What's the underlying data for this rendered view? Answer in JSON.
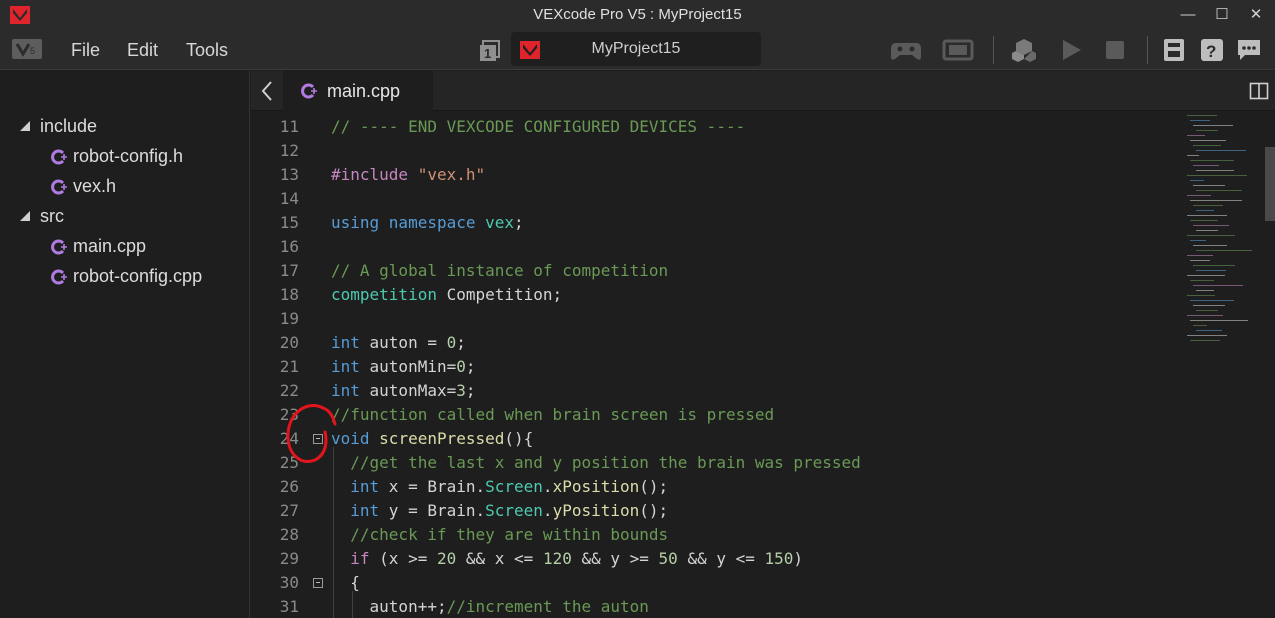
{
  "window": {
    "title": "VEXcode Pro V5 : MyProject15",
    "minimize_glyph": "—",
    "maximize_glyph": "☐",
    "close_glyph": "✕"
  },
  "menu": {
    "items": [
      "File",
      "Edit",
      "Tools"
    ]
  },
  "project": {
    "count": "1",
    "name": "MyProject15"
  },
  "toolbar": {
    "icons": [
      "controller-icon",
      "brain-icon",
      "download-icon",
      "play-icon",
      "stop-icon",
      "device-info-icon",
      "help-icon",
      "feedback-icon"
    ]
  },
  "sidebar": {
    "folders": [
      {
        "name": "include",
        "files": [
          "robot-config.h",
          "vex.h"
        ]
      },
      {
        "name": "src",
        "files": [
          "main.cpp",
          "robot-config.cpp"
        ]
      }
    ]
  },
  "tab": {
    "label": "main.cpp"
  },
  "code": {
    "lines": [
      {
        "n": "11",
        "segs": [
          [
            "c-comment",
            "// ---- END VEXCODE CONFIGURED DEVICES ----"
          ]
        ]
      },
      {
        "n": "12",
        "segs": []
      },
      {
        "n": "13",
        "segs": [
          [
            "c-ctrl",
            "#include "
          ],
          [
            "c-str",
            "\"vex.h\""
          ]
        ]
      },
      {
        "n": "14",
        "segs": []
      },
      {
        "n": "15",
        "segs": [
          [
            "c-kw",
            "using namespace "
          ],
          [
            "c-type",
            "vex"
          ],
          [
            "c-var",
            ";"
          ]
        ]
      },
      {
        "n": "16",
        "segs": []
      },
      {
        "n": "17",
        "segs": [
          [
            "c-comment",
            "// A global instance of competition"
          ]
        ]
      },
      {
        "n": "18",
        "segs": [
          [
            "c-type",
            "competition "
          ],
          [
            "c-var",
            "Competition;"
          ]
        ]
      },
      {
        "n": "19",
        "segs": []
      },
      {
        "n": "20",
        "segs": [
          [
            "c-kw",
            "int "
          ],
          [
            "c-var",
            "auton = "
          ],
          [
            "c-num",
            "0"
          ],
          [
            "c-var",
            ";"
          ]
        ]
      },
      {
        "n": "21",
        "segs": [
          [
            "c-kw",
            "int "
          ],
          [
            "c-var",
            "autonMin="
          ],
          [
            "c-num",
            "0"
          ],
          [
            "c-var",
            ";"
          ]
        ]
      },
      {
        "n": "22",
        "segs": [
          [
            "c-kw",
            "int "
          ],
          [
            "c-var",
            "autonMax="
          ],
          [
            "c-num",
            "3"
          ],
          [
            "c-var",
            ";"
          ]
        ]
      },
      {
        "n": "23",
        "segs": [
          [
            "c-comment",
            "//function called when brain screen is pressed"
          ]
        ]
      },
      {
        "n": "24",
        "fold": true,
        "segs": [
          [
            "c-kw",
            "void "
          ],
          [
            "c-fn",
            "screenPressed"
          ],
          [
            "c-var",
            "(){"
          ]
        ]
      },
      {
        "n": "25",
        "segs": [
          [
            "c-comment",
            "  //get the last x and y position the brain was pressed"
          ]
        ]
      },
      {
        "n": "26",
        "segs": [
          [
            "c-kw",
            "  int "
          ],
          [
            "c-var",
            "x = Brain."
          ],
          [
            "c-type",
            "Screen"
          ],
          [
            "c-var",
            "."
          ],
          [
            "c-fn",
            "xPosition"
          ],
          [
            "c-var",
            "();"
          ]
        ]
      },
      {
        "n": "27",
        "segs": [
          [
            "c-kw",
            "  int "
          ],
          [
            "c-var",
            "y = Brain."
          ],
          [
            "c-type",
            "Screen"
          ],
          [
            "c-var",
            "."
          ],
          [
            "c-fn",
            "yPosition"
          ],
          [
            "c-var",
            "();"
          ]
        ]
      },
      {
        "n": "28",
        "segs": [
          [
            "c-comment",
            "  //check if they are within bounds"
          ]
        ]
      },
      {
        "n": "29",
        "segs": [
          [
            "c-ctrl",
            "  if "
          ],
          [
            "c-var",
            "(x >= "
          ],
          [
            "c-num",
            "20"
          ],
          [
            "c-var",
            " && x <= "
          ],
          [
            "c-num",
            "120"
          ],
          [
            "c-var",
            " && y >= "
          ],
          [
            "c-num",
            "50"
          ],
          [
            "c-var",
            " && y <= "
          ],
          [
            "c-num",
            "150"
          ],
          [
            "c-var",
            ")"
          ]
        ]
      },
      {
        "n": "30",
        "fold": true,
        "segs": [
          [
            "c-var",
            "  {"
          ]
        ]
      },
      {
        "n": "31",
        "segs": [
          [
            "c-var",
            "    auton++;"
          ],
          [
            "c-comment",
            "//increment the auton"
          ]
        ]
      }
    ]
  },
  "colors": {
    "accent_red": "#e0242b",
    "annotation_red": "#e3151c"
  }
}
